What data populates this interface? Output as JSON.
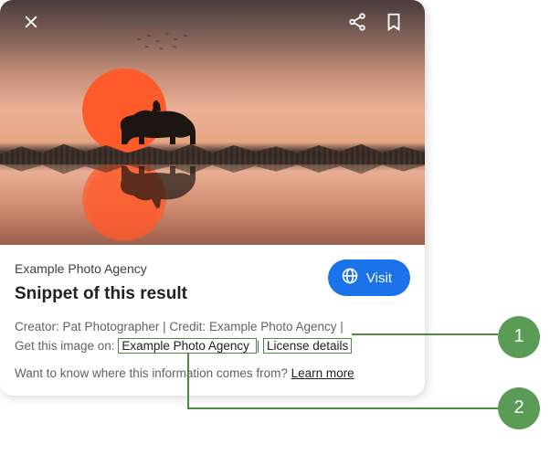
{
  "topbar": {
    "close_icon": "close",
    "share_icon": "share",
    "bookmark_icon": "bookmark"
  },
  "card": {
    "source": "Example Photo Agency",
    "snippet": "Snippet of this result",
    "visit_label": "Visit",
    "globe_icon": "globe",
    "meta": {
      "creator_label": "Creator:",
      "creator_value": "Pat Photographer",
      "credit_label": "Credit:",
      "credit_value": "Example Photo Agency",
      "get_image_label": "Get this image on:",
      "provider_link": "Example Photo Agency",
      "license_link": "License details"
    },
    "footer": {
      "question": "Want to know where this information comes from?",
      "learn_more": "Learn more"
    }
  },
  "annotations": {
    "badge1": "1",
    "badge2": "2"
  }
}
